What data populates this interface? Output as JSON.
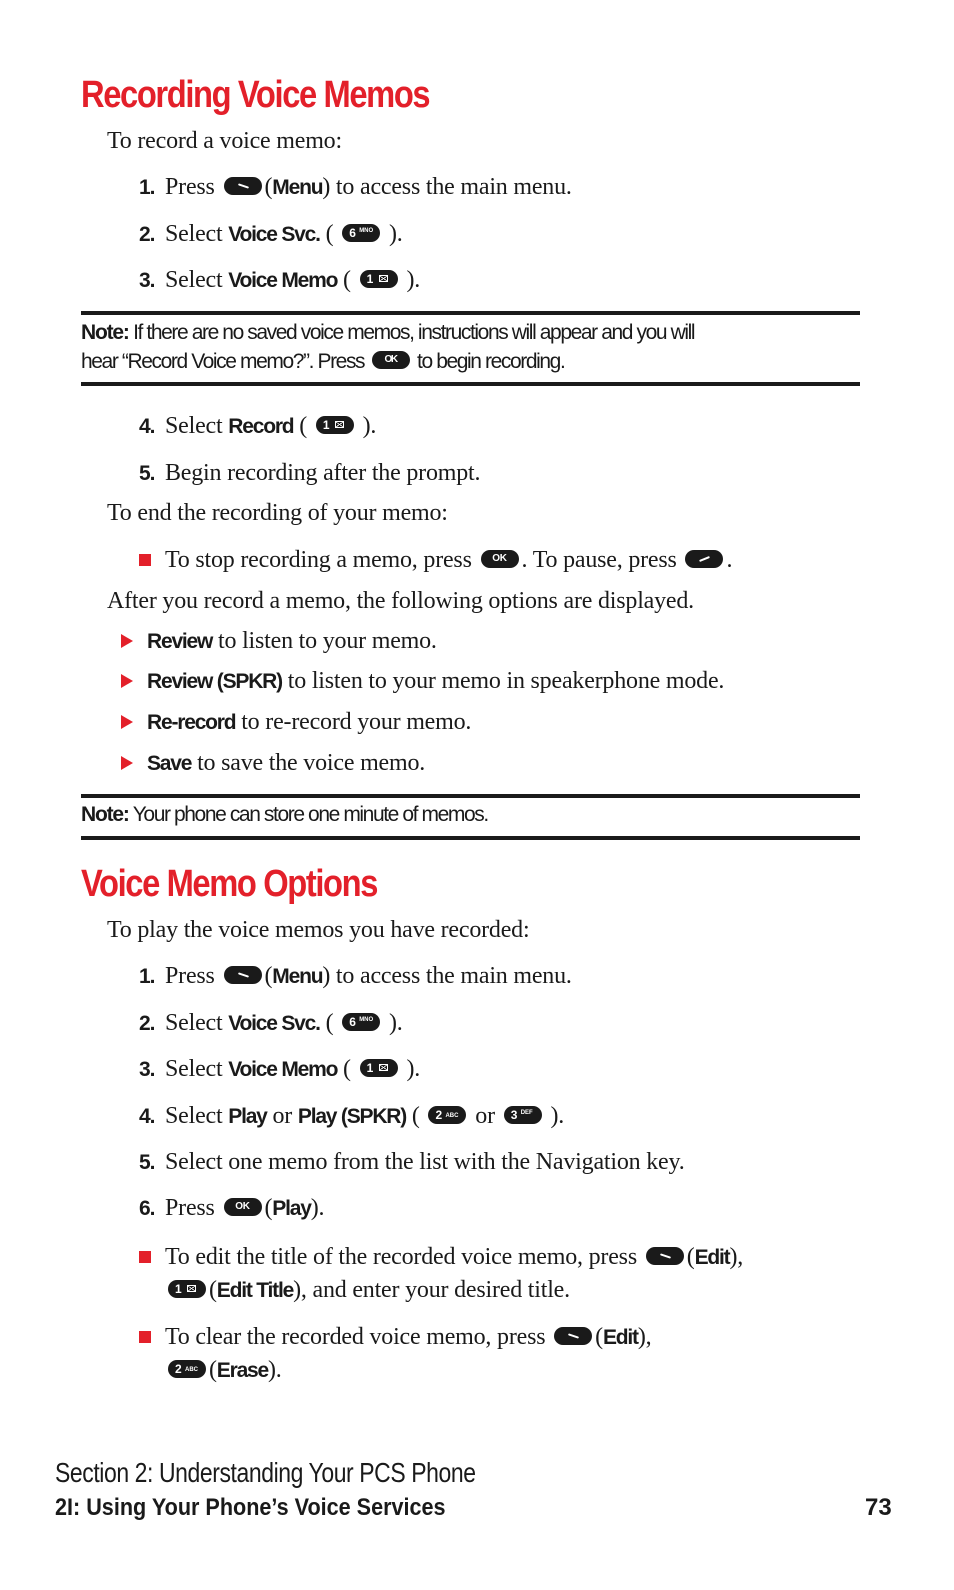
{
  "section1": {
    "title": "Recording Voice Memos",
    "intro": "To record a voice memo:",
    "steps_a": [
      {
        "num": "1.",
        "pre": "Press",
        "key": "left-softkey",
        "open": "(",
        "bold": "Menu",
        "post": ") to access the main menu."
      },
      {
        "num": "2.",
        "pre": "Select",
        "bold": "Voice Svc.",
        "open": " (",
        "key_main": "6",
        "key_sub": "MNO",
        "post": " )."
      },
      {
        "num": "3.",
        "pre": "Select",
        "bold": "Voice Memo",
        "open": " (",
        "key_main": "1",
        "post": " )."
      }
    ],
    "note1": {
      "label": "Note:",
      "line1": "If there are no saved voice memos, instructions will appear and you will",
      "line2_pre": "hear “Record Voice memo?”. Press",
      "key": "OK",
      "line2_post": "to begin recording."
    },
    "steps_b": [
      {
        "num": "4.",
        "pre": "Select",
        "bold": "Record",
        "open": " (",
        "key_main": "1",
        "post": " )."
      },
      {
        "num": "5.",
        "text": "Begin recording after the prompt."
      }
    ],
    "end_intro": "To end the recording of your memo:",
    "end_bullet": {
      "pre": "To stop recording a memo, press",
      "key": "OK",
      "mid": ". To pause, press",
      "post": "."
    },
    "after_intro": "After you record a memo, the following options are displayed.",
    "options": [
      {
        "bold": "Review",
        "text": "to listen to your memo."
      },
      {
        "bold": "Review (SPKR)",
        "text": "to listen to your memo in speakerphone mode."
      },
      {
        "bold": "Re-record",
        "text": "to re-record your memo."
      },
      {
        "bold": "Save",
        "text": "to save the voice memo."
      }
    ],
    "note2": {
      "label": "Note:",
      "text": "Your phone can store one minute of memos."
    }
  },
  "section2": {
    "title": "Voice Memo Options",
    "intro": "To play the voice memos you have recorded:",
    "steps": [
      {
        "num": "1.",
        "pre": "Press",
        "open": "(",
        "bold": "Menu",
        "post": ") to access the main menu."
      },
      {
        "num": "2.",
        "pre": "Select",
        "bold": "Voice Svc.",
        "open": " (",
        "key_main": "6",
        "key_sub": "MNO",
        "post": " )."
      },
      {
        "num": "3.",
        "pre": "Select",
        "bold": "Voice Memo",
        "open": " (",
        "key_main": "1",
        "post": " )."
      },
      {
        "num": "4.",
        "pre": "Select",
        "bold": "Play",
        "or1": "or",
        "bold2": "Play (SPKR)",
        "open": " (",
        "key1_main": "2",
        "key1_sub": "ABC",
        "or2": "or",
        "key2_main": "3",
        "key2_sub": "DEF",
        "post": " )."
      },
      {
        "num": "5.",
        "text": "Select one memo from the list with the Navigation key."
      },
      {
        "num": "6.",
        "pre": "Press",
        "key": "OK",
        "open": "(",
        "bold": "Play",
        "post": ")."
      }
    ],
    "bullets": [
      {
        "pre": "To edit the title of the recorded voice memo, press",
        "open": "(",
        "bold": "Edit",
        "post": "),",
        "line2_key_main": "1",
        "line2_open": "(",
        "line2_bold": "Edit Title",
        "line2_post": "), and enter your desired title."
      },
      {
        "pre": "To clear the recorded voice memo, press",
        "open": "(",
        "bold": "Edit",
        "post": "),",
        "line2_key_main": "2",
        "line2_key_sub": "ABC",
        "line2_open": "(",
        "line2_bold": "Erase",
        "line2_post": ")."
      }
    ]
  },
  "footer": {
    "section": "Section 2: Understanding Your PCS Phone",
    "chapter": "2I: Using Your Phone’s Voice Services",
    "page": "73"
  },
  "colors": {
    "accent": "#e3202a",
    "text": "#1a1a1a"
  }
}
